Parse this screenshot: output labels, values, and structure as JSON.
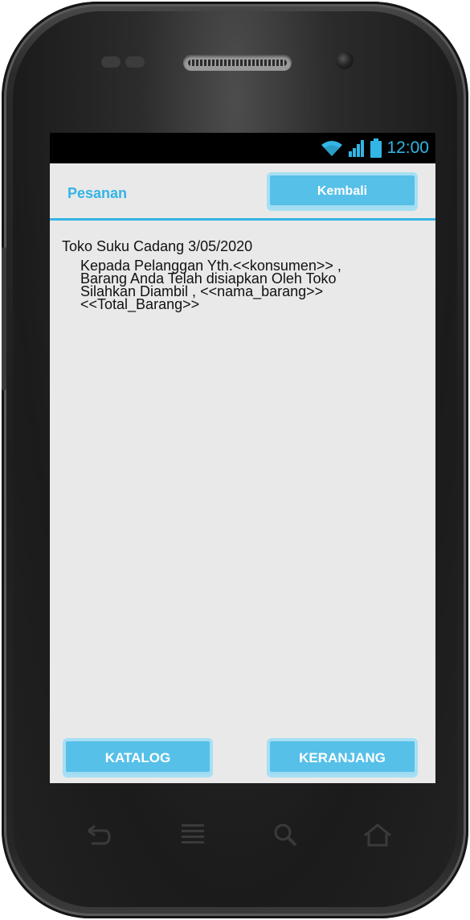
{
  "status_bar": {
    "time": "12:00",
    "icons": [
      "wifi-icon",
      "signal-icon",
      "battery-icon"
    ]
  },
  "header": {
    "title": "Pesanan",
    "back_button": "Kembali"
  },
  "content": {
    "title": "Toko Suku Cadang 3/05/2020",
    "message_lines": [
      "Kepada Pelanggan Yth.<<konsumen>> ,",
      "Barang Anda Telah disiapkan Oleh Toko",
      "Silahkan Diambil , <<nama_barang>>",
      "<<Total_Barang>>"
    ]
  },
  "footer": {
    "catalog_button": "KATALOG",
    "cart_button": "KERANJANG"
  },
  "device_nav": {
    "icons": [
      "back-icon",
      "menu-icon",
      "search-icon",
      "home-icon"
    ]
  },
  "colors": {
    "accent": "#33b5e5",
    "button": "#56c0e8",
    "screen_bg": "#e9e9e9"
  }
}
